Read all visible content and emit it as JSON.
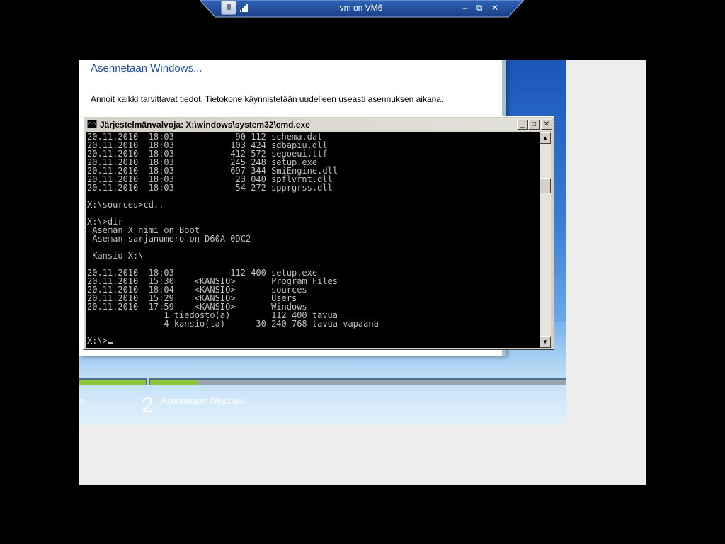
{
  "session_bar": {
    "title": "vm on VM6",
    "minimize_label": "‒",
    "restore_label": "⧉",
    "close_label": "✕",
    "icons": [
      "pin-icon",
      "connection-signal-icon"
    ]
  },
  "setup": {
    "heading": "Asennetaan Windows...",
    "info": "Annoit kaikki tarvittavat tiedot. Tietokone käynnistetään uudelleen useasti asennuksen aikana.",
    "progress": {
      "completed_segment": 1,
      "current_segment_fraction": 0.13
    },
    "steps": {
      "prev_label_fragment": "a",
      "current_number": "2",
      "current_label": "Asennetaan Windows"
    }
  },
  "cmd": {
    "title": "Järjestelmänvalvoja: X:\\windows\\system32\\cmd.exe",
    "icon_text": "C:\\",
    "buttons": {
      "minimize": "_",
      "maximize": "□",
      "close": "✕"
    },
    "lines": [
      "20.11.2010  18:03            90 112 schema.dat",
      "20.11.2010  18:03           103 424 sdbapiu.dll",
      "20.11.2010  18:03           412 572 segoeui.ttf",
      "20.11.2010  18:03           245 248 setup.exe",
      "20.11.2010  18:03           697 344 SmiEngine.dll",
      "20.11.2010  18:03            23 040 spflvrnt.dll",
      "20.11.2010  18:03            54 272 spprgrss.dll",
      "",
      "X:\\sources>cd..",
      "",
      "X:\\>dir",
      " Aseman X nimi on Boot",
      " Aseman sarjanumero on D60A-0DC2",
      "",
      " Kansio X:\\",
      "",
      "20.11.2010  18:03           112 400 setup.exe",
      "20.11.2010  15:30    <KANSIO>       Program Files",
      "20.11.2010  18:04    <KANSIO>       sources",
      "20.11.2010  15:29    <KANSIO>       Users",
      "20.11.2010  17:59    <KANSIO>       Windows",
      "               1 tiedosto(a)        112 400 tavua",
      "               4 kansio(ta)      30 240 768 tavua vapaana",
      "",
      "X:\\>"
    ],
    "scrollbar": {
      "up": "▲",
      "down": "▼"
    }
  }
}
